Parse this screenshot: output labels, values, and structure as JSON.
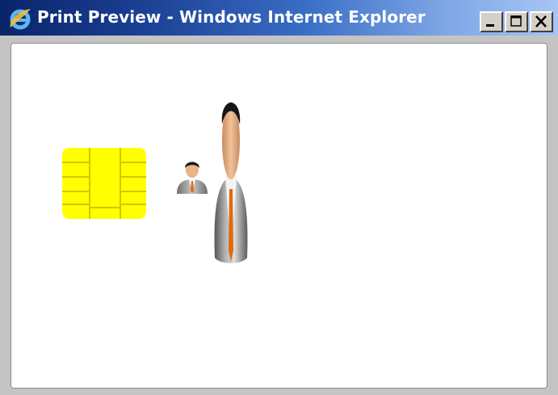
{
  "window": {
    "title": "Print Preview - Windows Internet Explorer",
    "title_icon": "internet-explorer-icon",
    "controls": [
      "minimize",
      "maximize",
      "close"
    ]
  },
  "content": {
    "images": [
      {
        "name": "smart-card-chip-image",
        "icon": "chip",
        "color": "#ffff00"
      },
      {
        "name": "person-small-image",
        "icon": "businessman"
      },
      {
        "name": "person-stretched-image",
        "icon": "businessman"
      }
    ]
  },
  "colors": {
    "titlebar_start": "#0a246a",
    "titlebar_end": "#a6c6f3",
    "chip_yellow": "#ffff00",
    "chip_lines": "#d6c400",
    "tie_orange": "#e06a10"
  }
}
